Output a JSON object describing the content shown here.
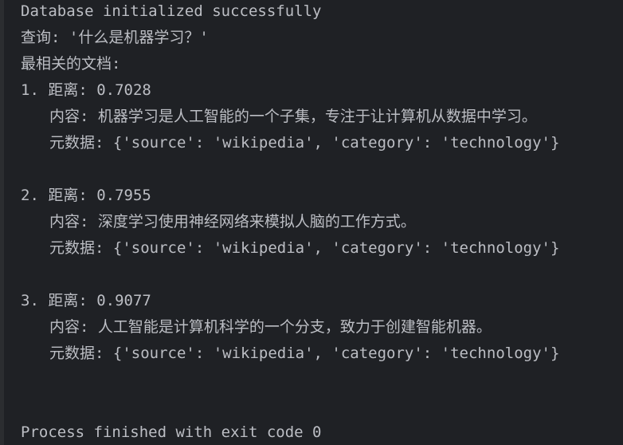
{
  "console": {
    "lines": [
      "Database initialized successfully",
      "查询: '什么是机器学习？'",
      "最相关的文档:"
    ],
    "results": [
      {
        "header": "1. 距离: 0.7028",
        "content": "内容: 机器学习是人工智能的一个子集，专注于让计算机从数据中学习。",
        "metadata": "元数据: {'source': 'wikipedia', 'category': 'technology'}"
      },
      {
        "header": "2. 距离: 0.7955",
        "content": "内容: 深度学习使用神经网络来模拟人脑的工作方式。",
        "metadata": "元数据: {'source': 'wikipedia', 'category': 'technology'}"
      },
      {
        "header": "3. 距离: 0.9077",
        "content": "内容: 人工智能是计算机科学的一个分支，致力于创建智能机器。",
        "metadata": "元数据: {'source': 'wikipedia', 'category': 'technology'}"
      }
    ],
    "exit_message": "Process finished with exit code 0"
  },
  "colors": {
    "background": "#1f2125",
    "text": "#bcbec4"
  }
}
